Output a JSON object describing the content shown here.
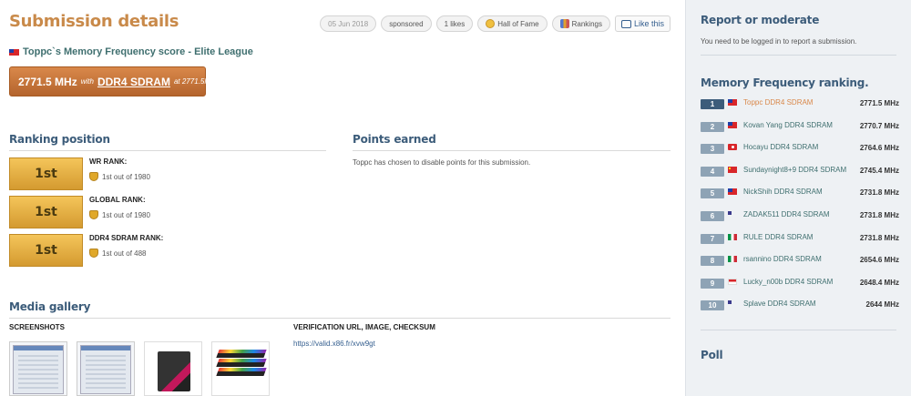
{
  "page": {
    "title": "Submission details"
  },
  "topbar": {
    "date": "05 Jun 2018",
    "sponsored": "sponsored",
    "likes": "1 likes",
    "hall_of_fame": "Hall of Fame",
    "rankings": "Rankings",
    "like": "Like this"
  },
  "submission": {
    "heading": "Toppc`s Memory Frequency score - Elite League",
    "result_mhz": "2771.5 MHz",
    "with": "with",
    "memory": "DDR4 SDRAM",
    "at": "at 2771.5MHz"
  },
  "ranking": {
    "title": "Ranking position",
    "items": [
      {
        "rank": "1st",
        "label": "WR RANK:",
        "detail": "1st out of 1980"
      },
      {
        "rank": "1st",
        "label": "GLOBAL RANK:",
        "detail": "1st out of 1980"
      },
      {
        "rank": "1st",
        "label": "DDR4 SDRAM RANK:",
        "detail": "1st out of 488"
      }
    ]
  },
  "points": {
    "title": "Points earned",
    "text": "Toppc has chosen to disable points for this submission."
  },
  "media": {
    "title": "Media gallery",
    "screenshots_label": "SCREENSHOTS",
    "verification_label": "VERIFICATION URL, IMAGE, CHECKSUM",
    "verification_url": "https://valid.x86.fr/xvw9gt"
  },
  "sidebar": {
    "report_title": "Report or moderate",
    "report_text": "You need to be logged in to report a submission.",
    "ranking_title": "Memory Frequency ranking.",
    "ranking": [
      {
        "pos": "1",
        "flag": "tw",
        "name": "Toppc DDR4 SDRAM",
        "value": "2771.5 MHz"
      },
      {
        "pos": "2",
        "flag": "tw",
        "name": "Kovan Yang DDR4 SDRAM",
        "value": "2770.7 MHz"
      },
      {
        "pos": "3",
        "flag": "hk",
        "name": "Hocayu DDR4 SDRAM",
        "value": "2764.6 MHz"
      },
      {
        "pos": "4",
        "flag": "cn",
        "name": "Sundaynight8+9 DDR4 SDRAM",
        "value": "2745.4 MHz"
      },
      {
        "pos": "5",
        "flag": "tw",
        "name": "NickShih DDR4 SDRAM",
        "value": "2731.8 MHz"
      },
      {
        "pos": "6",
        "flag": "us",
        "name": "ZADAK511 DDR4 SDRAM",
        "value": "2731.8 MHz"
      },
      {
        "pos": "7",
        "flag": "it",
        "name": "RULE DDR4 SDRAM",
        "value": "2731.8 MHz"
      },
      {
        "pos": "8",
        "flag": "it",
        "name": "rsannino DDR4 SDRAM",
        "value": "2654.6 MHz"
      },
      {
        "pos": "9",
        "flag": "id",
        "name": "Lucky_n00b DDR4 SDRAM",
        "value": "2648.4 MHz"
      },
      {
        "pos": "10",
        "flag": "us",
        "name": "Splave DDR4 SDRAM",
        "value": "2644 MHz"
      }
    ],
    "poll_title": "Poll"
  }
}
